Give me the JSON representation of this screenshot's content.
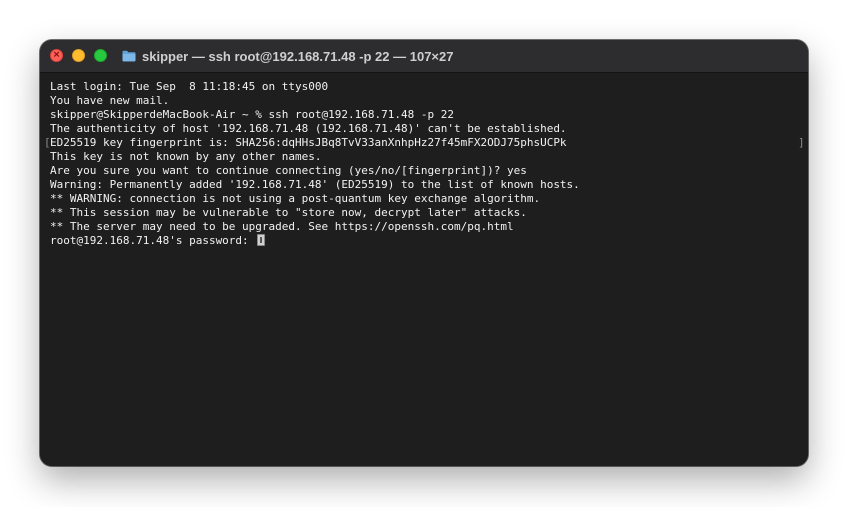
{
  "window": {
    "title": "skipper — ssh root@192.168.71.48 -p 22 — 107×27",
    "folder_icon": "folder-icon"
  },
  "terminal": {
    "lines": [
      "Last login: Tue Sep  8 11:18:45 on ttys000",
      "You have new mail.",
      "skipper@SkipperdeMacBook-Air ~ % ssh root@192.168.71.48 -p 22",
      "The authenticity of host '192.168.71.48 (192.168.71.48)' can't be established.",
      "ED25519 key fingerprint is: SHA256:dqHHsJBq8TvV33anXnhpHz27f45mFX2ODJ75phsUCPk",
      "This key is not known by any other names.",
      "Are you sure you want to continue connecting (yes/no/[fingerprint])? yes",
      "Warning: Permanently added '192.168.71.48' (ED25519) to the list of known hosts.",
      "** WARNING: connection is not using a post-quantum key exchange algorithm.",
      "** This session may be vulnerable to \"store now, decrypt later\" attacks.",
      "** The server may need to be upgraded. See https://openssh.com/pq.html",
      "root@192.168.71.48's password: "
    ],
    "marker_left": "[",
    "marker_right": "]"
  },
  "colors": {
    "background": "#1e1e1e",
    "titlebar": "#2d2d2f",
    "text": "#f2f2f2",
    "close": "#ff5f57",
    "minimize": "#febc2e",
    "zoom": "#28c840"
  }
}
